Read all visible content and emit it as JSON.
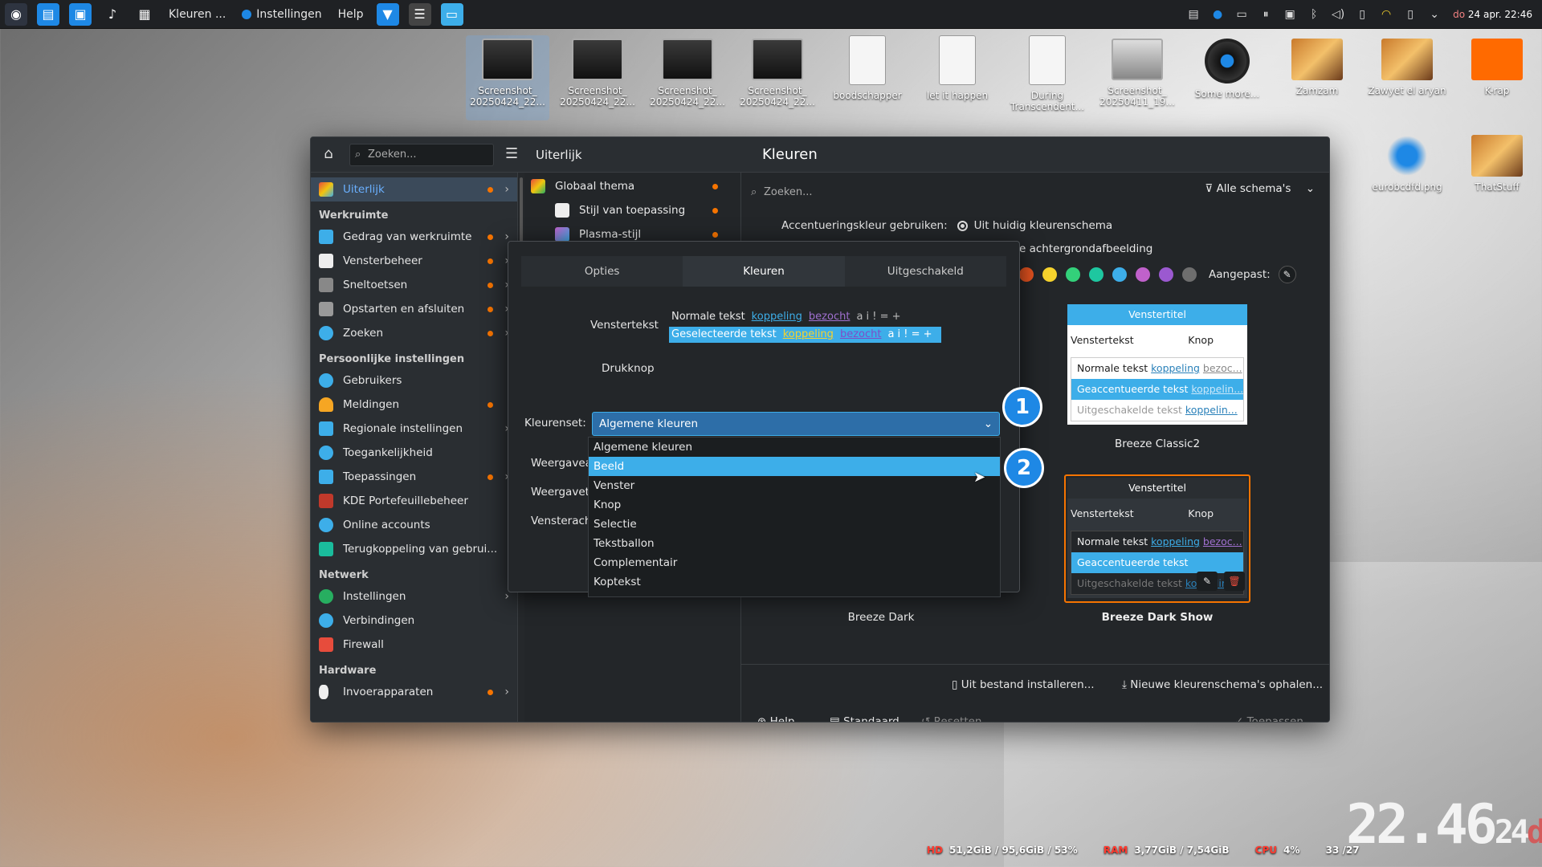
{
  "top_panel": {
    "task_kleuren": "Kleuren ...",
    "task_instellingen": "Instellingen",
    "menu_help": "Help",
    "clock_day": "do",
    "clock_date": "24 apr.",
    "clock_time": "22:46"
  },
  "desktop_icons": [
    {
      "label": "Screenshot_ 20250424_22..."
    },
    {
      "label": "Screenshot_ 20250424_22..."
    },
    {
      "label": "Screenshot_ 20250424_22..."
    },
    {
      "label": "Screenshot_ 20250424_22..."
    },
    {
      "label": "boodschapper"
    },
    {
      "label": "let it happen"
    },
    {
      "label": "During Transcendent..."
    },
    {
      "label": "Screenshot_ 20250411_19..."
    },
    {
      "label": "Some more..."
    },
    {
      "label": "Zamzam"
    },
    {
      "label": "Zawyet el aryan"
    },
    {
      "label": "K-rap"
    },
    {
      "label": "eurobcdfd.png"
    },
    {
      "label": "ThatStuff"
    }
  ],
  "header": {
    "search_placeholder": "Zoeken...",
    "crumb_left": "Uiterlijk",
    "crumb_right": "Kleuren"
  },
  "sidebar": {
    "top_item": "Uiterlijk",
    "sections": {
      "werkruimte": "Werkruimte",
      "persoonlijk": "Persoonlijke instellingen",
      "netwerk": "Netwerk",
      "hardware": "Hardware"
    },
    "items": {
      "gedrag": "Gedrag van werkruimte",
      "vensterbeheer": "Vensterbeheer",
      "sneltoetsen": "Sneltoetsen",
      "opstarten": "Opstarten en afsluiten",
      "zoeken": "Zoeken",
      "gebruikers": "Gebruikers",
      "meldingen": "Meldingen",
      "regionaal": "Regionale instellingen",
      "toegankelijkheid": "Toegankelijkheid",
      "toepassingen": "Toepassingen",
      "kde_wallet": "KDE Portefeuillebeheer",
      "online": "Online accounts",
      "terugkoppeling": "Terugkoppeling van gebrui...",
      "net_instellingen": "Instellingen",
      "verbindingen": "Verbindingen",
      "firewall": "Firewall",
      "invoer": "Invoerapparaten"
    }
  },
  "midlist": {
    "globaal": "Globaal thema",
    "stijl": "Stijl van toepassing",
    "plasma": "Plasma-stijl"
  },
  "content": {
    "search_placeholder": "Zoeken...",
    "filter": "Alle schema's",
    "accent_label": "Accentueringskleur gebruiken:",
    "accent_option1": "Uit huidig kleurenschema",
    "accent_option2": "e achtergrondafbeelding",
    "custom_label": "Aangepast:",
    "swatch_colors": [
      "#e95420",
      "#f6d32d",
      "#33d17a",
      "#1ec7a0",
      "#3daee9",
      "#c061cb",
      "#9b59d0",
      "#6e6e6e"
    ],
    "preview1": {
      "title": "Venstertitel",
      "window_text": "Venstertekst",
      "button": "Knop",
      "normal": "Normale tekst",
      "link": "koppeling",
      "visited": "bezoc...",
      "accented": "Geaccentueerde tekst",
      "accented_link": "koppelin...",
      "disabled": "Uitgeschakelde tekst",
      "disabled_link": "koppelin...",
      "caption": "Breeze Classic2"
    },
    "preview2": {
      "title": "Venstertitel",
      "window_text": "Venstertekst",
      "button": "Knop",
      "normal": "Normale tekst",
      "link": "koppeling",
      "visited": "bezoc...",
      "accented": "Geaccentueerde tekst",
      "disabled": "Uitgeschakelde tekst",
      "disabled_link": "koppelin...",
      "caption": "Breeze Dark Show"
    },
    "caption_left": "Breeze Dark",
    "install_file": "Uit bestand installeren...",
    "get_new": "Nieuwe kleurenschema's ophalen...",
    "help": "Help",
    "standaard": "Standaard",
    "resetten": "Resetten",
    "toepassen": "Toepassen"
  },
  "dialog": {
    "tabs": [
      "Opties",
      "Kleuren",
      "Uitgeschakeld"
    ],
    "venstertekst_label": "Venstertekst",
    "normal_text": "Normale tekst",
    "link": "koppeling",
    "visited": "bezocht",
    "sample_chars": "a i ! = +",
    "selected_text": "Geselecteerde tekst",
    "drukknop": "Drukknop",
    "kleurenset_label": "Kleurenset:",
    "kleurenset_value": "Algemene kleuren",
    "weergave1": "Weergavea",
    "weergave2": "Weergavete",
    "vensterach": "Vensterach",
    "options": [
      "Algemene kleuren",
      "Beeld",
      "Venster",
      "Knop",
      "Selectie",
      "Tekstballon",
      "Complementair",
      "Koptekst"
    ]
  },
  "badges": {
    "one": "1",
    "two": "2"
  },
  "status": {
    "hd_label": "HD",
    "hd_value": "51,2GiB / 95,6GiB / 53%",
    "ram_label": "RAM",
    "ram_value": "3,77GiB / 7,54GiB",
    "cpu_label": "CPU",
    "cpu_value": "4%",
    "temp_value": "33 /27"
  },
  "big_clock": {
    "time": "22.46",
    "day_num": "24",
    "day": "do"
  }
}
